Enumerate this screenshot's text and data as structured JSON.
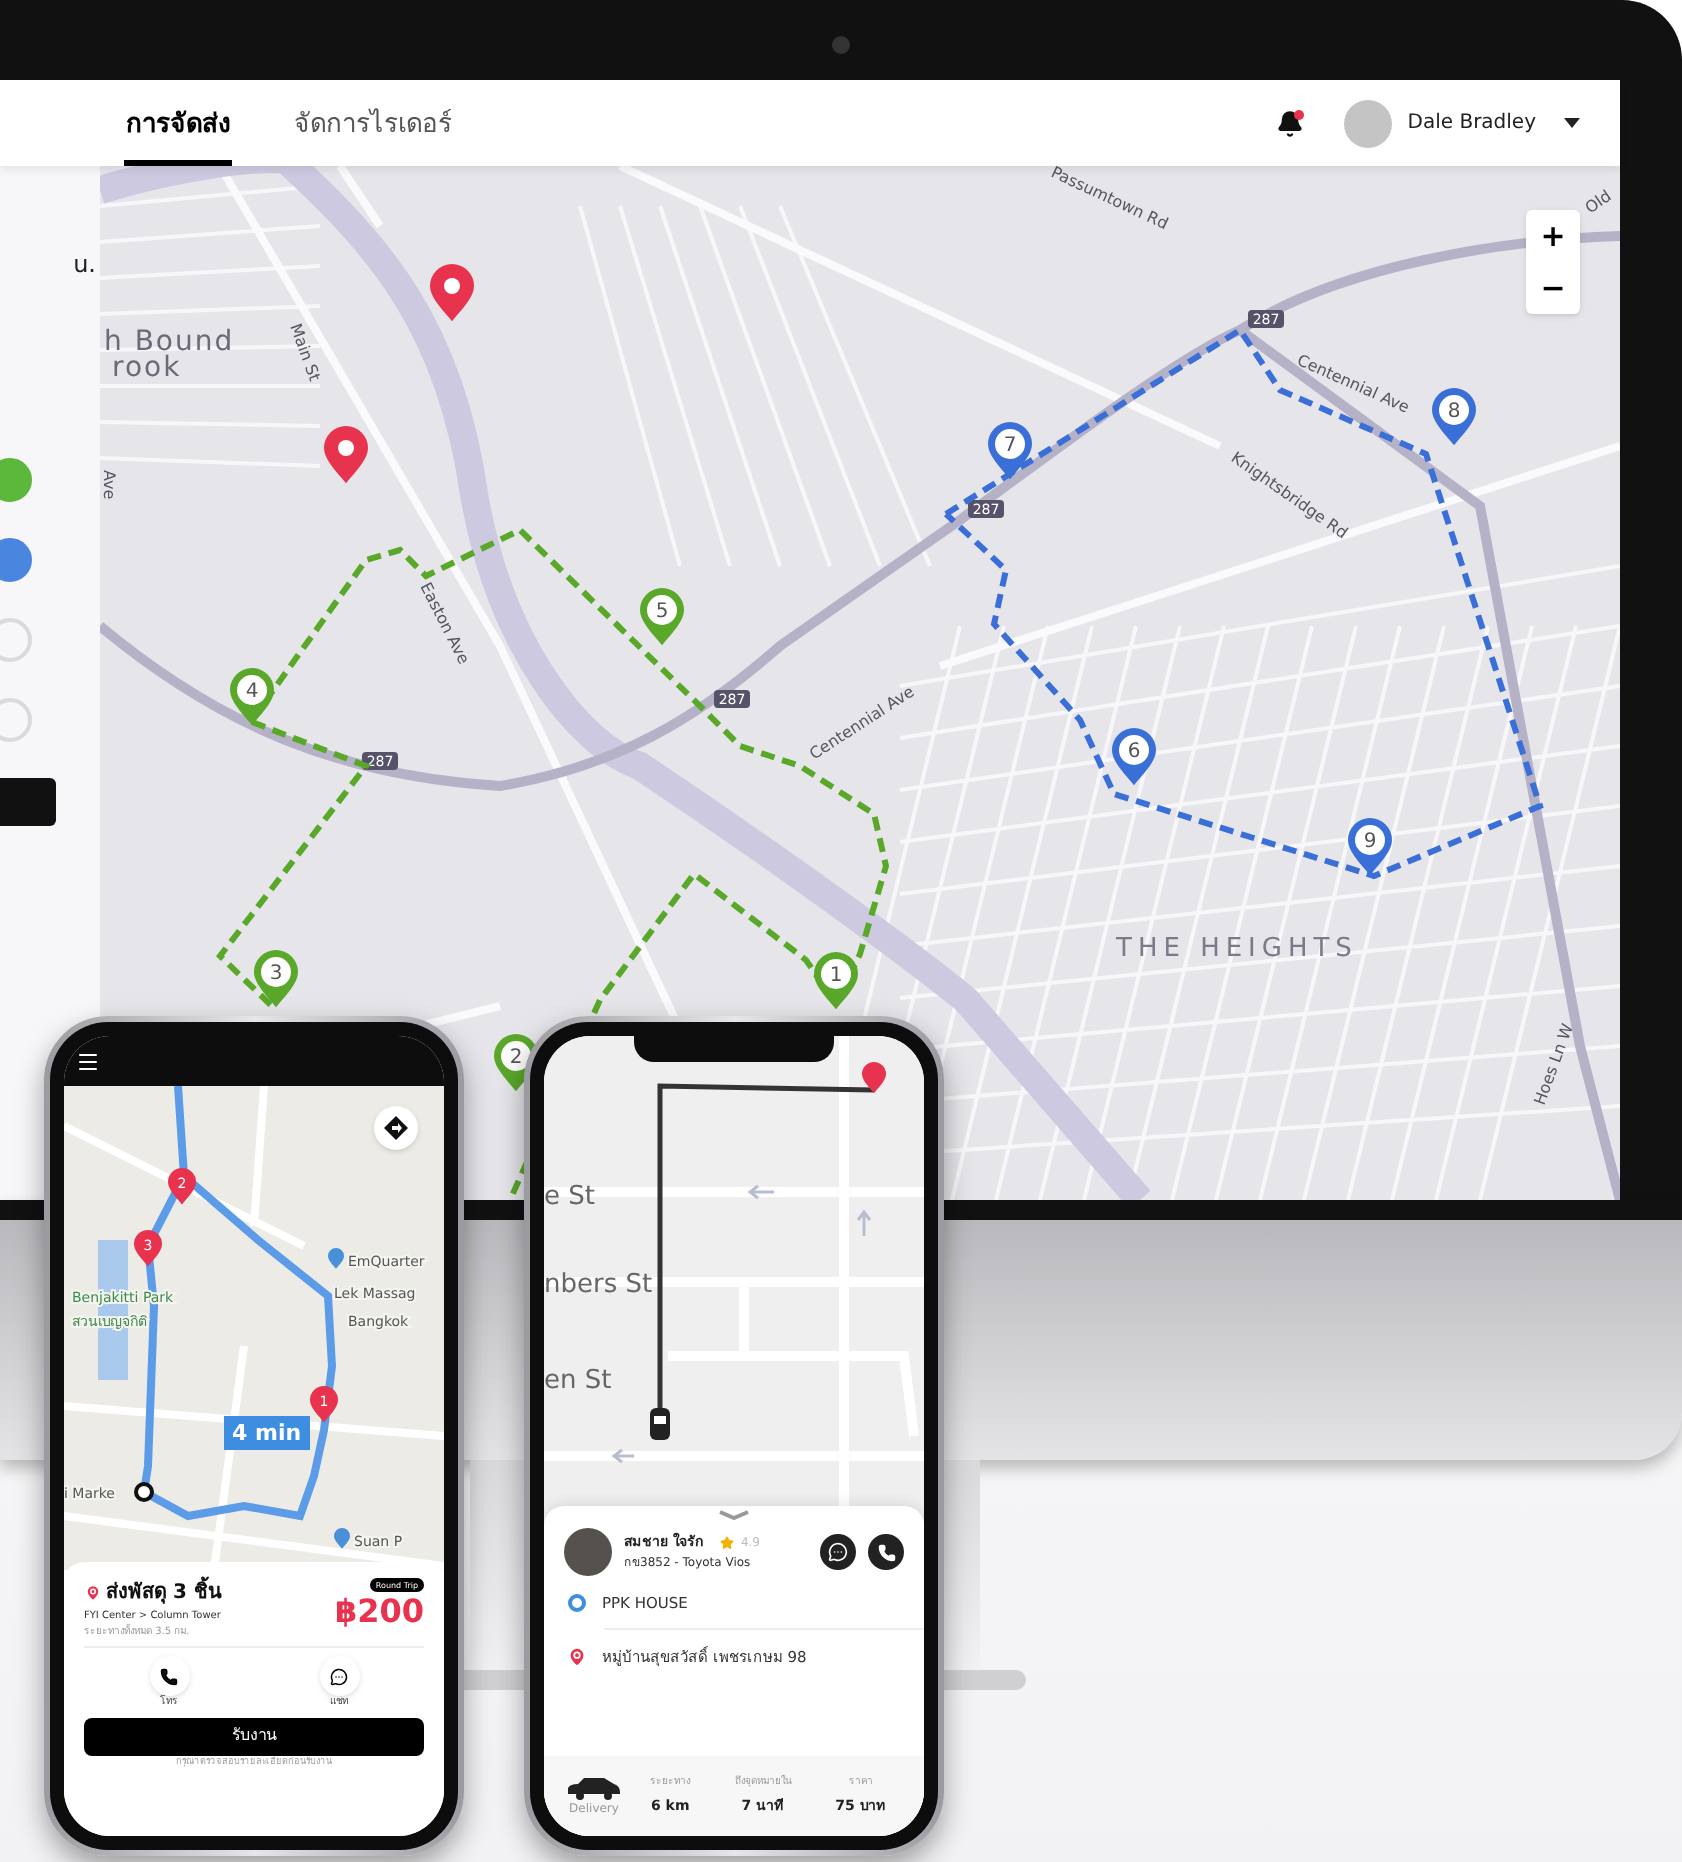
{
  "monitor": {
    "tabs": [
      {
        "label": "การจัดส่ง",
        "selected": true
      },
      {
        "label": "จัดการไรเดอร์",
        "selected": false
      }
    ],
    "notification": {
      "unread": true
    },
    "user": {
      "name": "Dale Bradley"
    },
    "side_panel": {
      "text": "u.",
      "dots": [
        {
          "kind": "filled",
          "color": "#5cb83a"
        },
        {
          "kind": "filled",
          "color": "#4a86e0"
        },
        {
          "kind": "outline",
          "color": "#d9d9de"
        },
        {
          "kind": "outline",
          "color": "#d9d9de"
        }
      ]
    },
    "map": {
      "zoom_in": "+",
      "zoom_out": "−",
      "labels": [
        "h Bound",
        "rook",
        "Main St",
        "Easton Ave",
        "Centennial Ave",
        "Passumtown Rd",
        "Centennial Ave",
        "Knightsbridge Rd",
        "THE HEIGHTS",
        "Hoes Ln W",
        "Old",
        "Ave"
      ],
      "highway_shields": [
        "287",
        "287",
        "287",
        "287"
      ],
      "markers": [
        {
          "label": "1",
          "color": "#5aa82a"
        },
        {
          "label": "2",
          "color": "#5aa82a"
        },
        {
          "label": "3",
          "color": "#5aa82a"
        },
        {
          "label": "4",
          "color": "#5aa82a"
        },
        {
          "label": "5",
          "color": "#5aa82a"
        },
        {
          "label": "6",
          "color": "#3a6fd8"
        },
        {
          "label": "7",
          "color": "#3a6fd8"
        },
        {
          "label": "8",
          "color": "#3a6fd8"
        },
        {
          "label": "9",
          "color": "#3a6fd8"
        }
      ],
      "pins": [
        {
          "color": "#e8334f"
        },
        {
          "color": "#e8334f"
        }
      ]
    }
  },
  "rider_app": {
    "map_labels": [
      "EmQuarter",
      "Lek Massag",
      "Bangkok",
      "Benjakitti Park",
      "สวนเบญจกิติ",
      "Suan P",
      "i Marke"
    ],
    "markers": [
      "1",
      "2",
      "3"
    ],
    "eta": "4 min",
    "job": {
      "title": "ส่งพัสดุ 3 ชิ้น",
      "route": "FYI Center > Column Tower",
      "distance": "ระยะทางทั้งหมด 3.5 กม.",
      "badge": "Round Trip",
      "price": "฿200"
    },
    "actions": [
      {
        "kind": "call",
        "label": "โทร"
      },
      {
        "kind": "chat",
        "label": "แชท"
      }
    ],
    "accept": "รับงาน",
    "note": "กรุณาตรวจสอบรายละเอียดก่อนรับงาน"
  },
  "customer_app": {
    "map_labels": [
      "e St",
      "nbers St",
      "en St"
    ],
    "driver": {
      "name": "สมชาย ใจรัก",
      "rating": "4.9",
      "vehicle": "กข3852 - Toyota Vios"
    },
    "pickup": "PPK HOUSE",
    "dropoff": "หมู่บ้านสุขสวัสดิ์ เพชรเกษม 98",
    "service": "Delivery",
    "stats": [
      {
        "label": "ระยะทาง",
        "value": "6 km"
      },
      {
        "label": "ถึงจุดหมายใน",
        "value": "7 นาที"
      },
      {
        "label": "ราคา",
        "value": "75 บาท"
      }
    ]
  }
}
